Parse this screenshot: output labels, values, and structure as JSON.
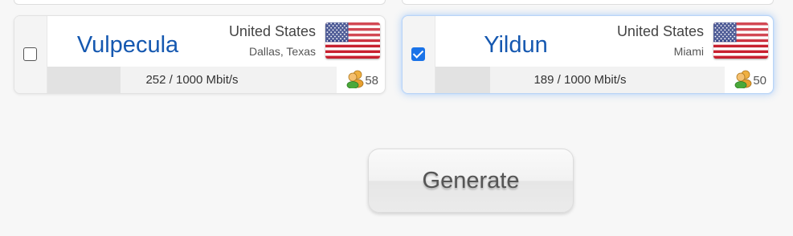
{
  "servers": [
    {
      "name": "Vulpecula",
      "country": "United States",
      "city": "Dallas, Texas",
      "speed": "252 / 1000 Mbit/s",
      "load_fraction": 0.252,
      "users": "58",
      "selected": false,
      "flag_icon": "us-flag-icon"
    },
    {
      "name": "Yildun",
      "country": "United States",
      "city": "Miami",
      "speed": "189 / 1000 Mbit/s",
      "load_fraction": 0.189,
      "users": "50",
      "selected": true,
      "flag_icon": "us-flag-icon"
    }
  ],
  "generate_button": {
    "label": "Generate"
  },
  "colors": {
    "name": "#1558b0",
    "checkbox_checked": "#1a73e8",
    "selected_glow": "#5096f0"
  }
}
